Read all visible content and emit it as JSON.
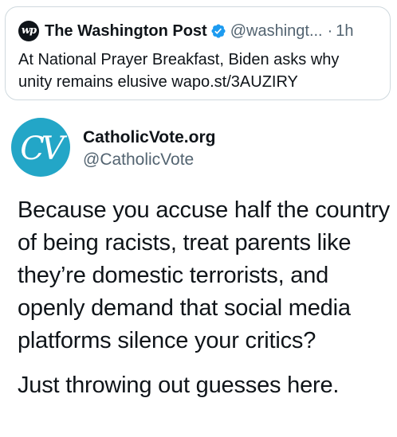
{
  "quoted_tweet": {
    "logo_text": "wp",
    "author_name": "The Washington Post",
    "verified_icon": "verified-badge-icon",
    "handle": "@washingt...",
    "separator": "·",
    "time": "1h",
    "text": "At National Prayer Breakfast, Biden asks why unity remains elusive wapo.st/3AUZIRY"
  },
  "tweet": {
    "avatar_text": "CV",
    "author_name": "CatholicVote.org",
    "handle": "@CatholicVote",
    "paragraphs": [
      "Because you accuse half the country of being racists, treat parents like they’re domestic terrorists, and openly demand that social media platforms silence your critics?",
      "Just throwing out guesses here."
    ]
  },
  "colors": {
    "text": "#0f1419",
    "secondary": "#536471",
    "verified_blue": "#1d9bf0",
    "avatar_teal": "#23a6c7",
    "card_border": "#cfd9de"
  }
}
